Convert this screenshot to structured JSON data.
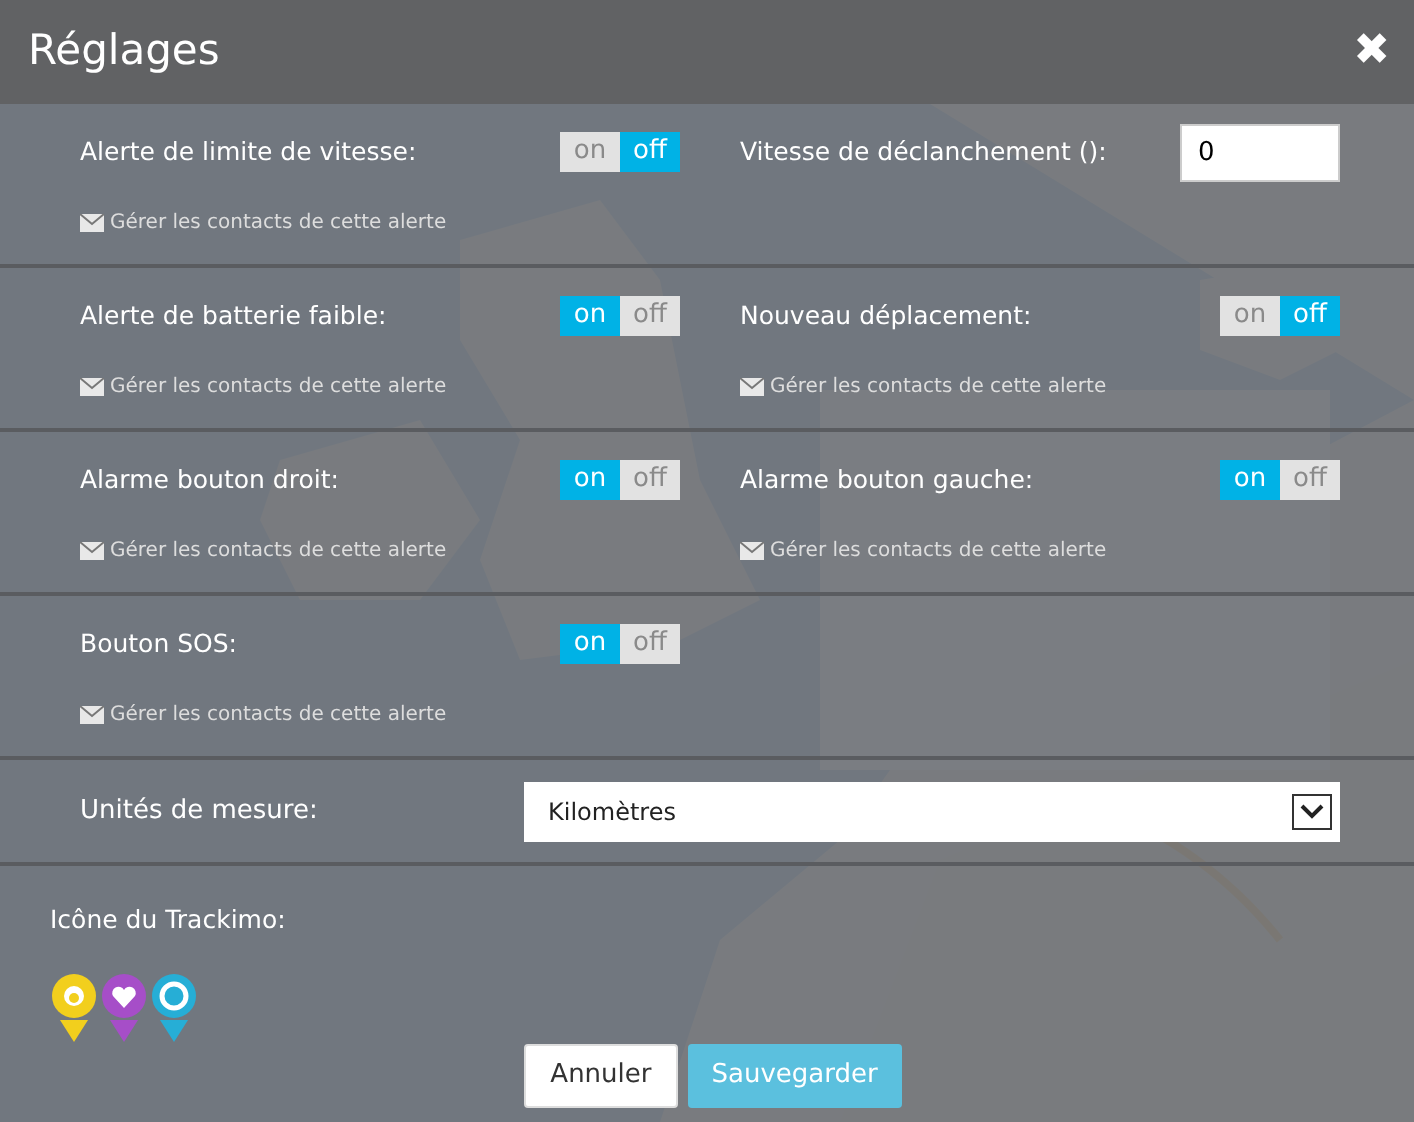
{
  "modal": {
    "title": "Réglages",
    "close": "✖"
  },
  "alert_rows": [
    {
      "cells": [
        {
          "kind": "toggle",
          "label": "Alerte de limite de vitesse:",
          "on": false,
          "on_text": "on",
          "off_text": "off",
          "link": "Gérer les contacts de cette alerte"
        },
        {
          "kind": "number",
          "label": "Vitesse de déclanchement ():",
          "value": "0"
        }
      ]
    },
    {
      "cells": [
        {
          "kind": "toggle",
          "label": "Alerte de batterie faible:",
          "on": true,
          "on_text": "on",
          "off_text": "off",
          "link": "Gérer les contacts de cette alerte"
        },
        {
          "kind": "toggle",
          "label": "Nouveau déplacement:",
          "on": false,
          "on_text": "on",
          "off_text": "off",
          "link": "Gérer les contacts de cette alerte"
        }
      ]
    },
    {
      "cells": [
        {
          "kind": "toggle",
          "label": "Alarme bouton droit:",
          "on": true,
          "on_text": "on",
          "off_text": "off",
          "link": "Gérer les contacts de cette alerte"
        },
        {
          "kind": "toggle",
          "label": "Alarme bouton gauche:",
          "on": true,
          "on_text": "on",
          "off_text": "off",
          "link": "Gérer les contacts de cette alerte"
        }
      ]
    },
    {
      "cells": [
        {
          "kind": "toggle",
          "label": "Bouton SOS:",
          "on": true,
          "on_text": "on",
          "off_text": "off",
          "link": "Gérer les contacts de cette alerte"
        }
      ]
    }
  ],
  "units": {
    "label": "Unités de mesure:",
    "value": "Kilomètres"
  },
  "tracker_icon": {
    "label": "Icône du Trackimo:",
    "pins": [
      {
        "kind": "paw",
        "color": "#f2cf1d"
      },
      {
        "kind": "heart",
        "color": "#a64ec8"
      },
      {
        "kind": "ring",
        "color": "#26aed6"
      }
    ]
  },
  "buttons": [
    {
      "kind": "cancel",
      "label": "Annuler"
    },
    {
      "kind": "save",
      "label": "Sauvegarder"
    }
  ]
}
